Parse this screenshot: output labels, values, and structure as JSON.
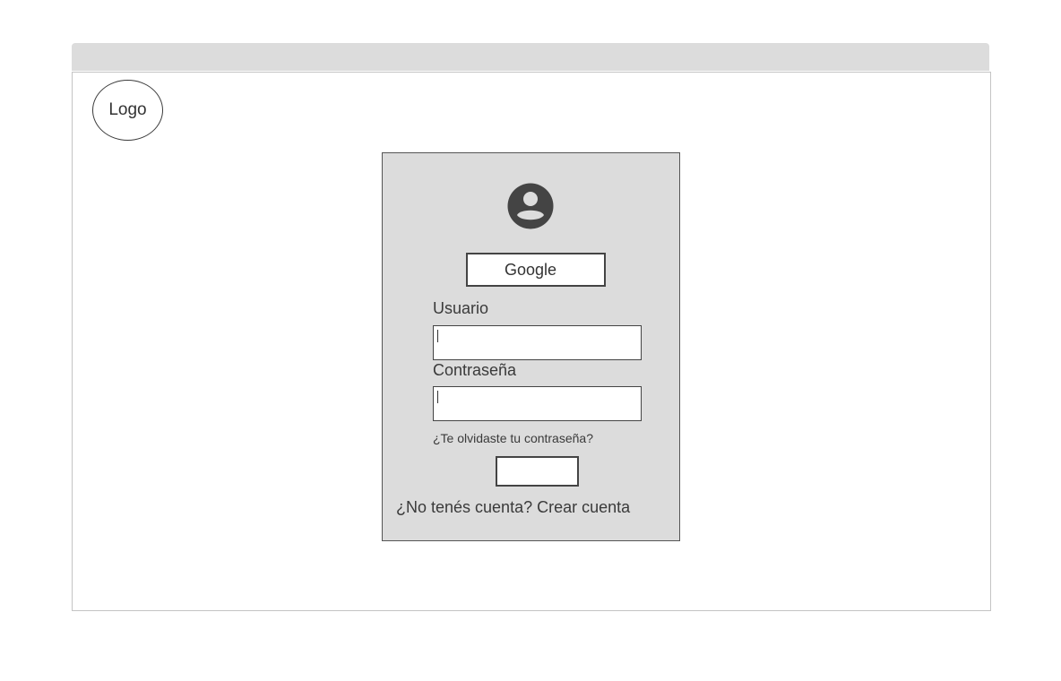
{
  "header": {
    "logo_label": "Logo"
  },
  "login": {
    "google_label": "Google",
    "username_label": "Usuario",
    "username_value": "",
    "password_label": "Contraseña",
    "password_value": "",
    "forgot_password": "¿Te olvidaste tu contraseña?",
    "submit_label": "",
    "no_account_text": "¿No tenés cuenta?",
    "create_account_link": "Crear cuenta"
  },
  "icons": {
    "avatar": "account-circle-icon"
  },
  "colors": {
    "panel_background": "#dcdcdc",
    "titlebar_background": "#dcdcdc",
    "icon_color": "#444444",
    "border": "#444444"
  }
}
